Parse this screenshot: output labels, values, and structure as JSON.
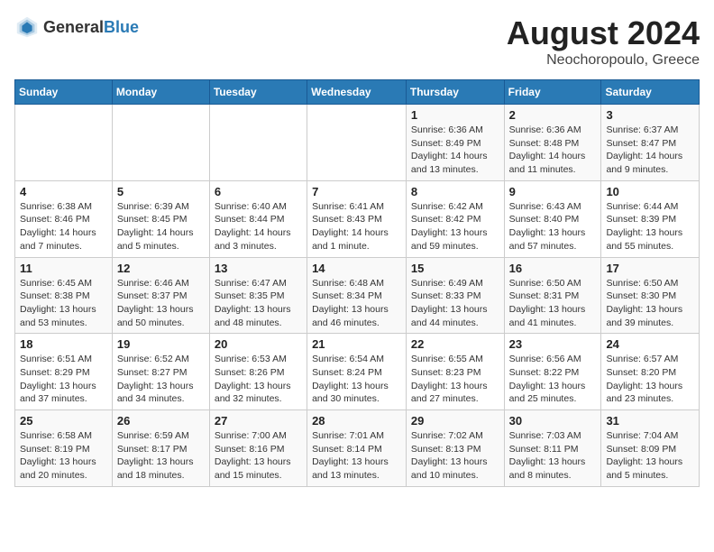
{
  "header": {
    "logo_general": "General",
    "logo_blue": "Blue",
    "title": "August 2024",
    "location": "Neochoropoulo, Greece"
  },
  "days_of_week": [
    "Sunday",
    "Monday",
    "Tuesday",
    "Wednesday",
    "Thursday",
    "Friday",
    "Saturday"
  ],
  "weeks": [
    [
      {
        "day": "",
        "info": ""
      },
      {
        "day": "",
        "info": ""
      },
      {
        "day": "",
        "info": ""
      },
      {
        "day": "",
        "info": ""
      },
      {
        "day": "1",
        "info": "Sunrise: 6:36 AM\nSunset: 8:49 PM\nDaylight: 14 hours\nand 13 minutes."
      },
      {
        "day": "2",
        "info": "Sunrise: 6:36 AM\nSunset: 8:48 PM\nDaylight: 14 hours\nand 11 minutes."
      },
      {
        "day": "3",
        "info": "Sunrise: 6:37 AM\nSunset: 8:47 PM\nDaylight: 14 hours\nand 9 minutes."
      }
    ],
    [
      {
        "day": "4",
        "info": "Sunrise: 6:38 AM\nSunset: 8:46 PM\nDaylight: 14 hours\nand 7 minutes."
      },
      {
        "day": "5",
        "info": "Sunrise: 6:39 AM\nSunset: 8:45 PM\nDaylight: 14 hours\nand 5 minutes."
      },
      {
        "day": "6",
        "info": "Sunrise: 6:40 AM\nSunset: 8:44 PM\nDaylight: 14 hours\nand 3 minutes."
      },
      {
        "day": "7",
        "info": "Sunrise: 6:41 AM\nSunset: 8:43 PM\nDaylight: 14 hours\nand 1 minute."
      },
      {
        "day": "8",
        "info": "Sunrise: 6:42 AM\nSunset: 8:42 PM\nDaylight: 13 hours\nand 59 minutes."
      },
      {
        "day": "9",
        "info": "Sunrise: 6:43 AM\nSunset: 8:40 PM\nDaylight: 13 hours\nand 57 minutes."
      },
      {
        "day": "10",
        "info": "Sunrise: 6:44 AM\nSunset: 8:39 PM\nDaylight: 13 hours\nand 55 minutes."
      }
    ],
    [
      {
        "day": "11",
        "info": "Sunrise: 6:45 AM\nSunset: 8:38 PM\nDaylight: 13 hours\nand 53 minutes."
      },
      {
        "day": "12",
        "info": "Sunrise: 6:46 AM\nSunset: 8:37 PM\nDaylight: 13 hours\nand 50 minutes."
      },
      {
        "day": "13",
        "info": "Sunrise: 6:47 AM\nSunset: 8:35 PM\nDaylight: 13 hours\nand 48 minutes."
      },
      {
        "day": "14",
        "info": "Sunrise: 6:48 AM\nSunset: 8:34 PM\nDaylight: 13 hours\nand 46 minutes."
      },
      {
        "day": "15",
        "info": "Sunrise: 6:49 AM\nSunset: 8:33 PM\nDaylight: 13 hours\nand 44 minutes."
      },
      {
        "day": "16",
        "info": "Sunrise: 6:50 AM\nSunset: 8:31 PM\nDaylight: 13 hours\nand 41 minutes."
      },
      {
        "day": "17",
        "info": "Sunrise: 6:50 AM\nSunset: 8:30 PM\nDaylight: 13 hours\nand 39 minutes."
      }
    ],
    [
      {
        "day": "18",
        "info": "Sunrise: 6:51 AM\nSunset: 8:29 PM\nDaylight: 13 hours\nand 37 minutes."
      },
      {
        "day": "19",
        "info": "Sunrise: 6:52 AM\nSunset: 8:27 PM\nDaylight: 13 hours\nand 34 minutes."
      },
      {
        "day": "20",
        "info": "Sunrise: 6:53 AM\nSunset: 8:26 PM\nDaylight: 13 hours\nand 32 minutes."
      },
      {
        "day": "21",
        "info": "Sunrise: 6:54 AM\nSunset: 8:24 PM\nDaylight: 13 hours\nand 30 minutes."
      },
      {
        "day": "22",
        "info": "Sunrise: 6:55 AM\nSunset: 8:23 PM\nDaylight: 13 hours\nand 27 minutes."
      },
      {
        "day": "23",
        "info": "Sunrise: 6:56 AM\nSunset: 8:22 PM\nDaylight: 13 hours\nand 25 minutes."
      },
      {
        "day": "24",
        "info": "Sunrise: 6:57 AM\nSunset: 8:20 PM\nDaylight: 13 hours\nand 23 minutes."
      }
    ],
    [
      {
        "day": "25",
        "info": "Sunrise: 6:58 AM\nSunset: 8:19 PM\nDaylight: 13 hours\nand 20 minutes."
      },
      {
        "day": "26",
        "info": "Sunrise: 6:59 AM\nSunset: 8:17 PM\nDaylight: 13 hours\nand 18 minutes."
      },
      {
        "day": "27",
        "info": "Sunrise: 7:00 AM\nSunset: 8:16 PM\nDaylight: 13 hours\nand 15 minutes."
      },
      {
        "day": "28",
        "info": "Sunrise: 7:01 AM\nSunset: 8:14 PM\nDaylight: 13 hours\nand 13 minutes."
      },
      {
        "day": "29",
        "info": "Sunrise: 7:02 AM\nSunset: 8:13 PM\nDaylight: 13 hours\nand 10 minutes."
      },
      {
        "day": "30",
        "info": "Sunrise: 7:03 AM\nSunset: 8:11 PM\nDaylight: 13 hours\nand 8 minutes."
      },
      {
        "day": "31",
        "info": "Sunrise: 7:04 AM\nSunset: 8:09 PM\nDaylight: 13 hours\nand 5 minutes."
      }
    ]
  ]
}
